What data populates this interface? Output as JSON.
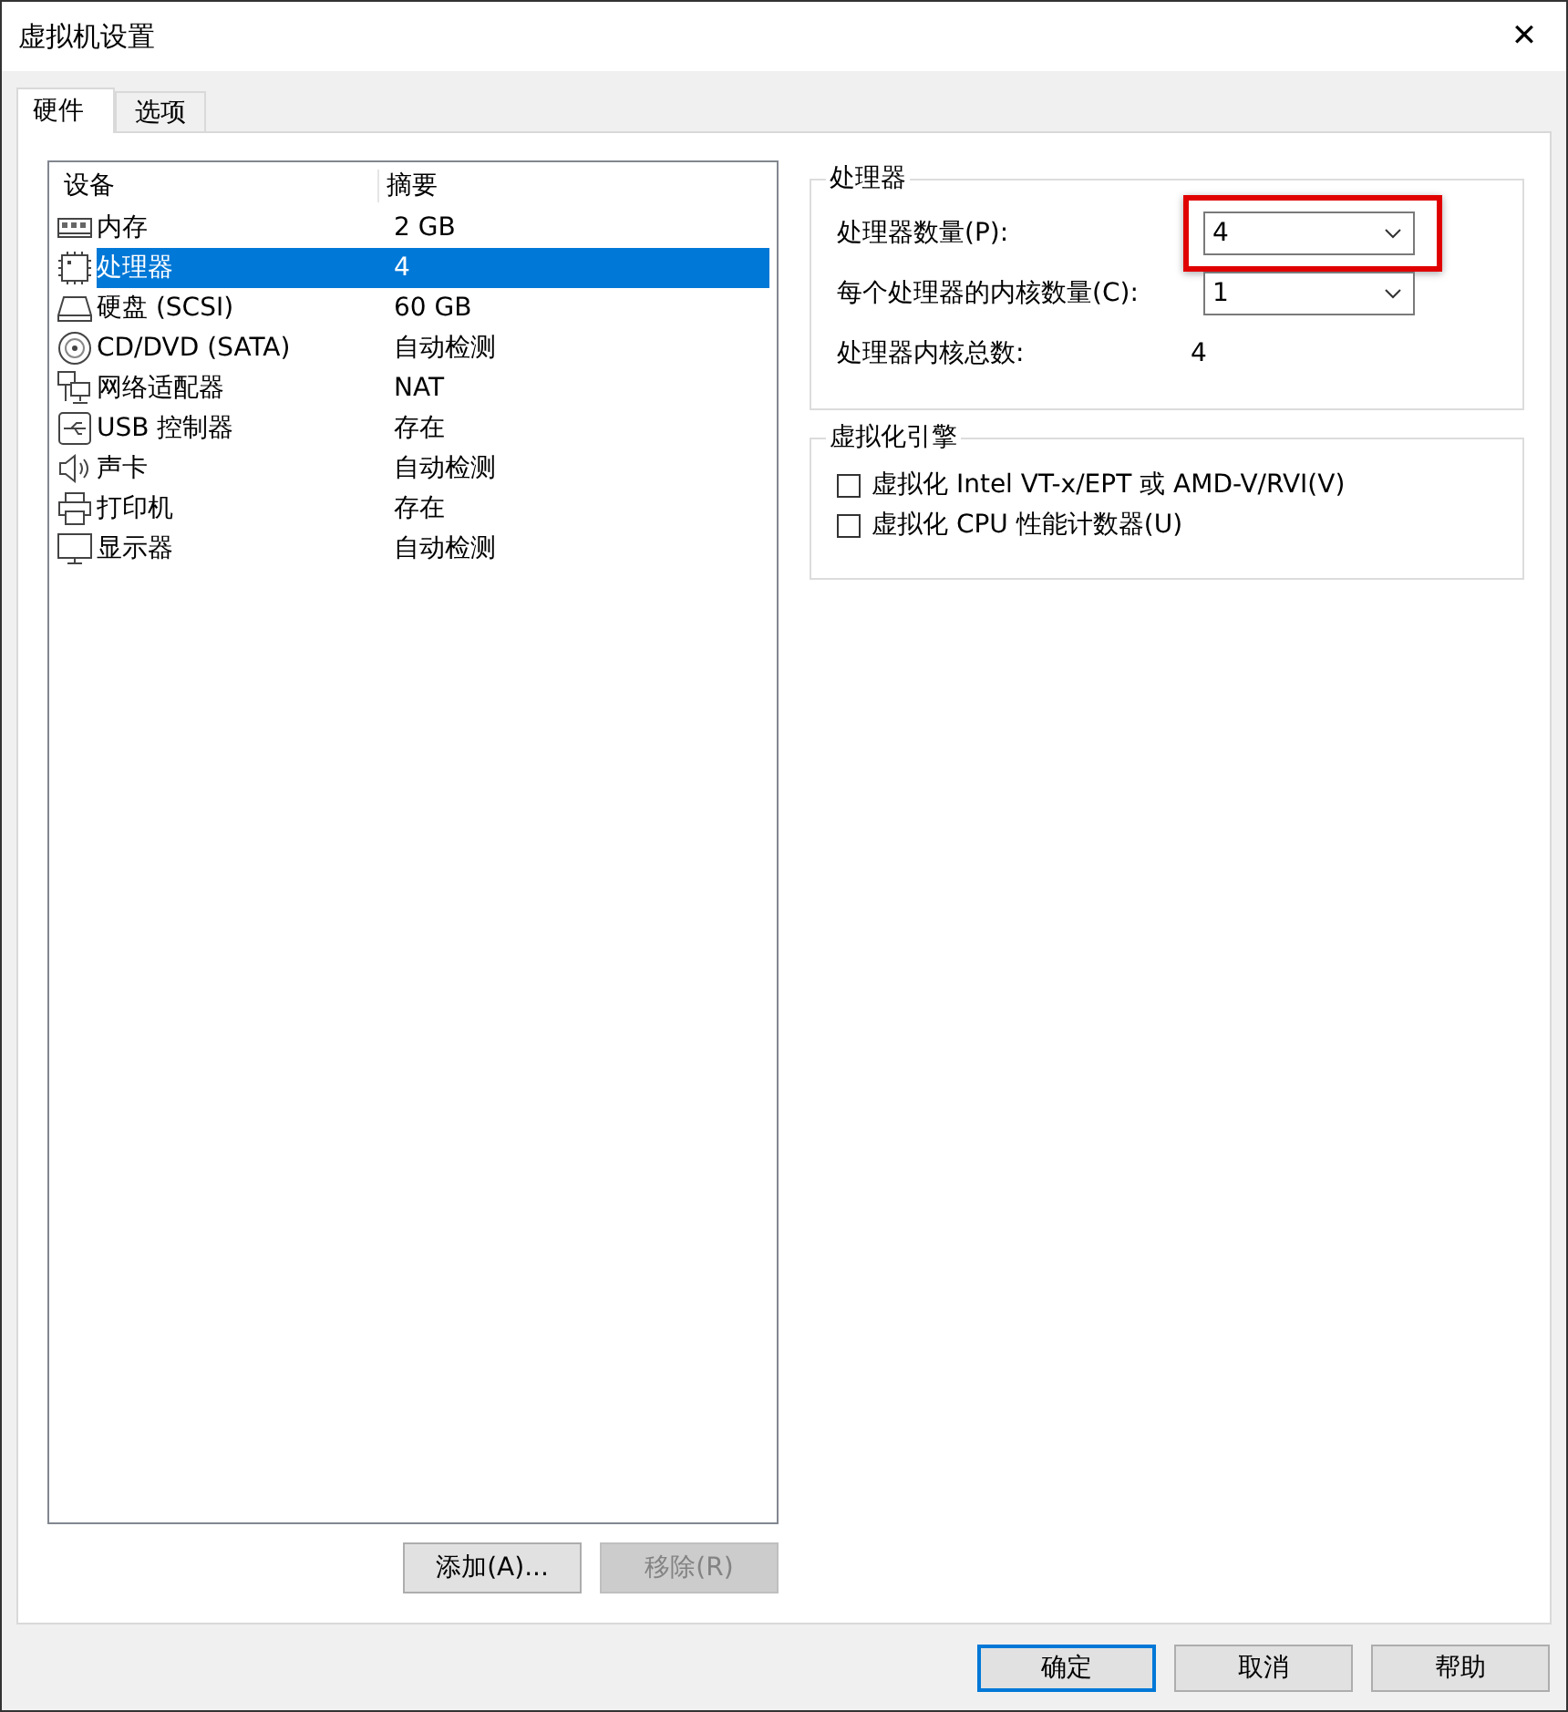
{
  "window": {
    "title": "虚拟机设置",
    "close": "✕"
  },
  "tabs": [
    {
      "label": "硬件",
      "selected": true
    },
    {
      "label": "选项",
      "selected": false
    }
  ],
  "device_list": {
    "columns": [
      "设备",
      "摘要"
    ],
    "rows": [
      {
        "kind": "memory",
        "device": "内存",
        "summary": "2 GB",
        "selected": false
      },
      {
        "kind": "cpu",
        "device": "处理器",
        "summary": "4",
        "selected": true
      },
      {
        "kind": "disk",
        "device": "硬盘 (SCSI)",
        "summary": "60 GB",
        "selected": false
      },
      {
        "kind": "cdrom",
        "device": "CD/DVD (SATA)",
        "summary": "自动检测",
        "selected": false
      },
      {
        "kind": "network",
        "device": "网络适配器",
        "summary": "NAT",
        "selected": false
      },
      {
        "kind": "usb",
        "device": "USB 控制器",
        "summary": "存在",
        "selected": false
      },
      {
        "kind": "sound",
        "device": "声卡",
        "summary": "自动检测",
        "selected": false
      },
      {
        "kind": "printer",
        "device": "打印机",
        "summary": "存在",
        "selected": false
      },
      {
        "kind": "display",
        "device": "显示器",
        "summary": "自动检测",
        "selected": false
      }
    ]
  },
  "list_buttons": [
    {
      "label": "添加(A)...",
      "disabled": false
    },
    {
      "label": "移除(R)",
      "disabled": true
    }
  ],
  "processor_group": {
    "title": "处理器",
    "fields": [
      {
        "kind": "combo",
        "label": "处理器数量(P):",
        "value": "4",
        "highlighted": true
      },
      {
        "kind": "combo",
        "label": "每个处理器的内核数量(C):",
        "value": "1",
        "highlighted": false
      },
      {
        "kind": "readout",
        "label": "处理器内核总数:",
        "value": "4"
      }
    ]
  },
  "virtualization_group": {
    "title": "虚拟化引擎",
    "options": [
      {
        "label": "虚拟化 Intel VT-x/EPT 或 AMD-V/RVI(V)",
        "checked": false
      },
      {
        "label": "虚拟化 CPU 性能计数器(U)",
        "checked": false
      }
    ]
  },
  "dialog_buttons": [
    {
      "label": "确定",
      "default": true
    },
    {
      "label": "取消",
      "default": false
    },
    {
      "label": "帮助",
      "default": false
    }
  ]
}
